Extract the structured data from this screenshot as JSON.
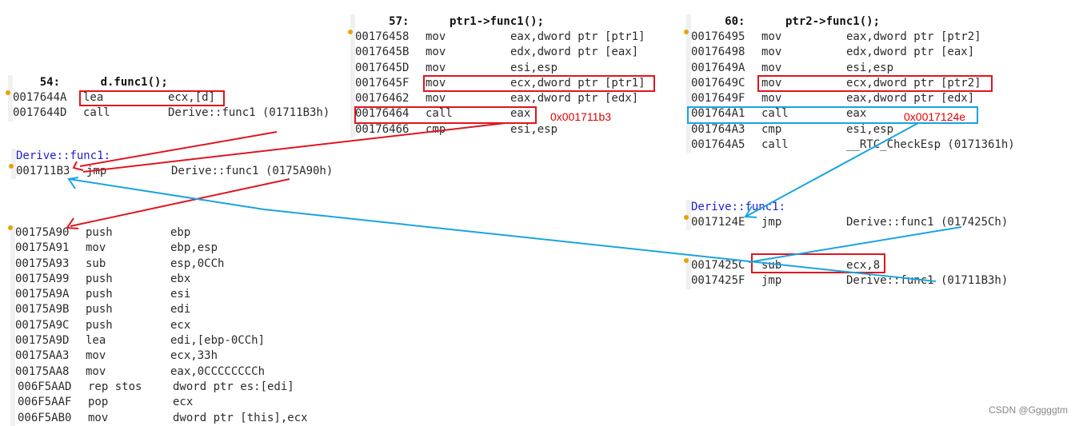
{
  "blockA": {
    "source_line": "    54:      d.func1();",
    "rows": [
      {
        "addr": "0017644A",
        "mnem": "lea",
        "ops": "ecx,[d]"
      },
      {
        "addr": "0017644D",
        "mnem": "call",
        "ops": "Derive::func1 (01711B3h)"
      }
    ]
  },
  "blockB": {
    "symbol": "Derive::func1:",
    "rows": [
      {
        "addr": "001711B3",
        "mnem": "jmp",
        "ops": "Derive::func1 (0175A90h)"
      }
    ]
  },
  "blockC": {
    "rows": [
      {
        "addr": "00175A90",
        "mnem": "push",
        "ops": "ebp"
      },
      {
        "addr": "00175A91",
        "mnem": "mov",
        "ops": "ebp,esp"
      },
      {
        "addr": "00175A93",
        "mnem": "sub",
        "ops": "esp,0CCh"
      },
      {
        "addr": "00175A99",
        "mnem": "push",
        "ops": "ebx"
      },
      {
        "addr": "00175A9A",
        "mnem": "push",
        "ops": "esi"
      },
      {
        "addr": "00175A9B",
        "mnem": "push",
        "ops": "edi"
      },
      {
        "addr": "00175A9C",
        "mnem": "push",
        "ops": "ecx"
      },
      {
        "addr": "00175A9D",
        "mnem": "lea",
        "ops": "edi,[ebp-0CCh]"
      },
      {
        "addr": "00175AA3",
        "mnem": "mov",
        "ops": "ecx,33h"
      },
      {
        "addr": "00175AA8",
        "mnem": "mov",
        "ops": "eax,0CCCCCCCCh"
      },
      {
        "addr": "006F5AAD",
        "mnem": "rep stos",
        "ops": "dword ptr es:[edi]"
      },
      {
        "addr": "006F5AAF",
        "mnem": "pop",
        "ops": "ecx"
      },
      {
        "addr": "006F5AB0",
        "mnem": "mov",
        "ops": "dword ptr [this],ecx"
      }
    ]
  },
  "blockD": {
    "source_line": "     57:      ptr1->func1();",
    "rows": [
      {
        "addr": "00176458",
        "mnem": "mov",
        "ops": "eax,dword ptr [ptr1]"
      },
      {
        "addr": "0017645B",
        "mnem": "mov",
        "ops": "edx,dword ptr [eax]"
      },
      {
        "addr": "0017645D",
        "mnem": "mov",
        "ops": "esi,esp"
      },
      {
        "addr": "0017645F",
        "mnem": "mov",
        "ops": "ecx,dword ptr [ptr1]"
      },
      {
        "addr": "00176462",
        "mnem": "mov",
        "ops": "eax,dword ptr [edx]"
      },
      {
        "addr": "00176464",
        "mnem": "call",
        "ops": "eax"
      },
      {
        "addr": "00176466",
        "mnem": "cmp",
        "ops": "esi,esp"
      }
    ],
    "annotation": "0x001711b3"
  },
  "blockE": {
    "source_line": "     60:      ptr2->func1();",
    "rows": [
      {
        "addr": "00176495",
        "mnem": "mov",
        "ops": "eax,dword ptr [ptr2]"
      },
      {
        "addr": "00176498",
        "mnem": "mov",
        "ops": "edx,dword ptr [eax]"
      },
      {
        "addr": "0017649A",
        "mnem": "mov",
        "ops": "esi,esp"
      },
      {
        "addr": "0017649C",
        "mnem": "mov",
        "ops": "ecx,dword ptr [ptr2]"
      },
      {
        "addr": "0017649F",
        "mnem": "mov",
        "ops": "eax,dword ptr [edx]"
      },
      {
        "addr": "001764A1",
        "mnem": "call",
        "ops": "eax"
      },
      {
        "addr": "001764A3",
        "mnem": "cmp",
        "ops": "esi,esp"
      },
      {
        "addr": "001764A5",
        "mnem": "call",
        "ops": "__RTC_CheckEsp (0171361h)"
      }
    ],
    "annotation": "0x0017124e"
  },
  "blockF": {
    "symbol": "Derive::func1:",
    "rows": [
      {
        "addr": "0017124E",
        "mnem": "jmp",
        "ops": "Derive::func1 (017425Ch)"
      }
    ]
  },
  "blockG": {
    "rows": [
      {
        "addr": "0017425C",
        "mnem": "sub",
        "ops": "ecx,8"
      },
      {
        "addr": "0017425F",
        "mnem": "jmp",
        "ops": "Derive::func1 (01711B3h)"
      }
    ]
  },
  "watermark": "CSDN @Gggggtm",
  "colors": {
    "red_highlight": "#e0151f",
    "blue_highlight": "#1aa3e0",
    "symbol_blue": "#1f1fd0",
    "annotation_red": "#e00000"
  }
}
